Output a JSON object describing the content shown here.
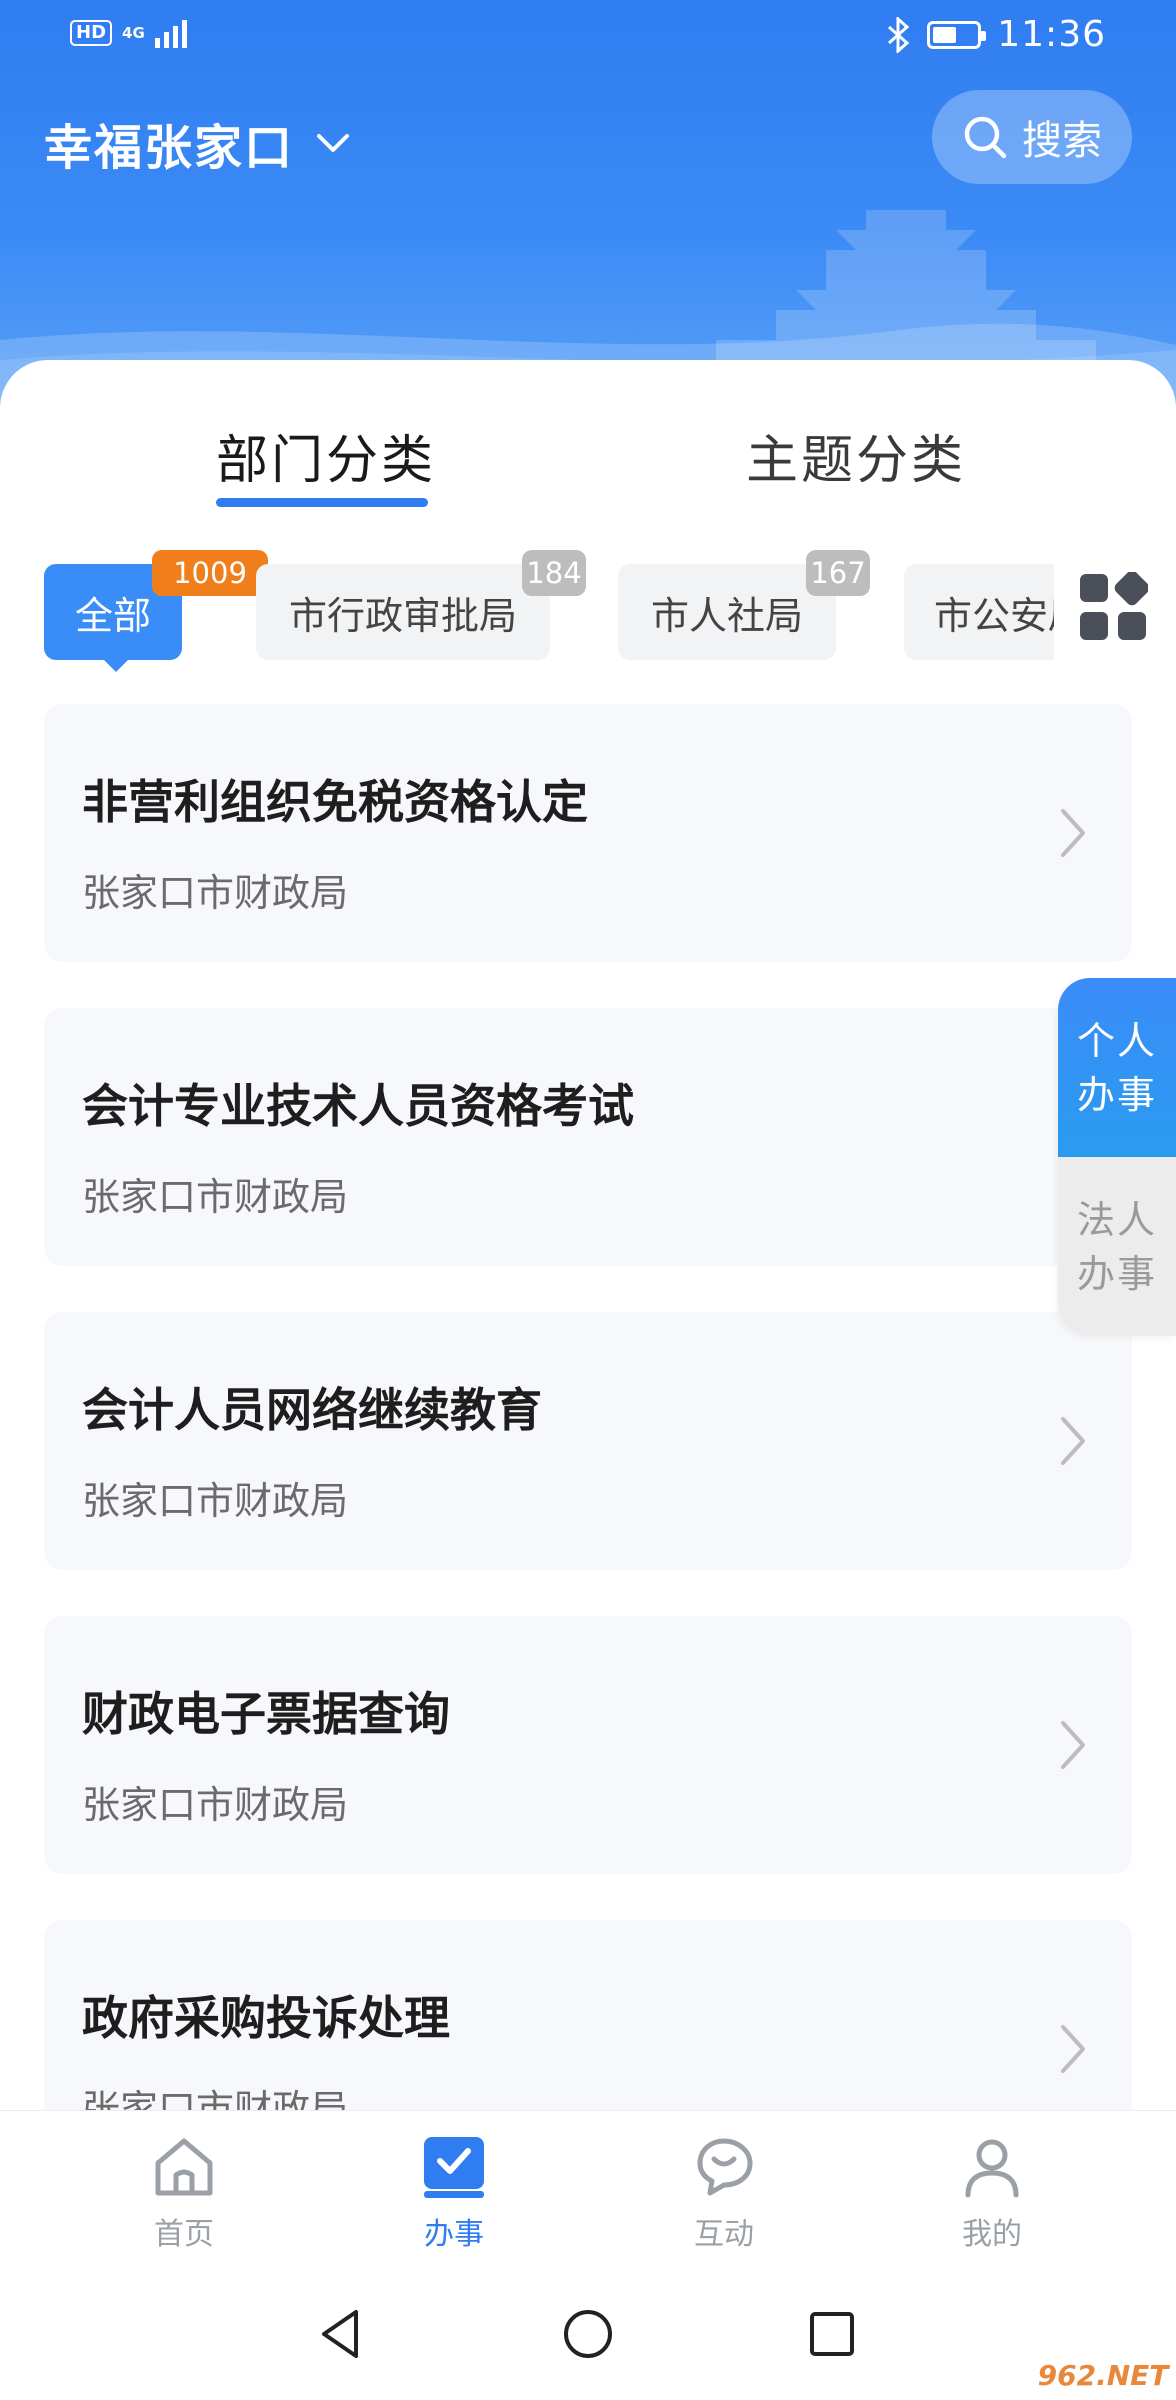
{
  "status_bar": {
    "hd": "HD",
    "network": "4G",
    "time": "11:36",
    "battery_level": 0.55
  },
  "header": {
    "city": "幸福张家口",
    "search_label": "搜索"
  },
  "category_tabs": [
    {
      "label": "部门分类",
      "active": true
    },
    {
      "label": "主题分类",
      "active": false
    }
  ],
  "departments": [
    {
      "label": "全部",
      "count": "1009",
      "active": true
    },
    {
      "label": "市行政审批局",
      "count": "184",
      "active": false
    },
    {
      "label": "市人社局",
      "count": "167",
      "active": false
    },
    {
      "label": "市公安局",
      "count": "",
      "active": false
    }
  ],
  "services": [
    {
      "title": "非营利组织免税资格认定",
      "dept": "张家口市财政局"
    },
    {
      "title": "会计专业技术人员资格考试",
      "dept": "张家口市财政局"
    },
    {
      "title": "会计人员网络继续教育",
      "dept": "张家口市财政局"
    },
    {
      "title": "财政电子票据查询",
      "dept": "张家口市财政局"
    },
    {
      "title": "政府采购投诉处理",
      "dept": "张家口市财政局"
    }
  ],
  "side_toggle": {
    "personal": "个人办事",
    "corporate": "法人办事"
  },
  "bottom_nav": [
    {
      "label": "首页",
      "icon": "home-icon",
      "active": false
    },
    {
      "label": "办事",
      "icon": "tasks-icon",
      "active": true
    },
    {
      "label": "互动",
      "icon": "chat-icon",
      "active": false
    },
    {
      "label": "我的",
      "icon": "user-icon",
      "active": false
    }
  ],
  "colors": {
    "brand_blue": "#2f7df1",
    "badge_orange": "#f07e1b",
    "badge_gray": "#bdbdbd"
  },
  "watermark": "962.NET"
}
